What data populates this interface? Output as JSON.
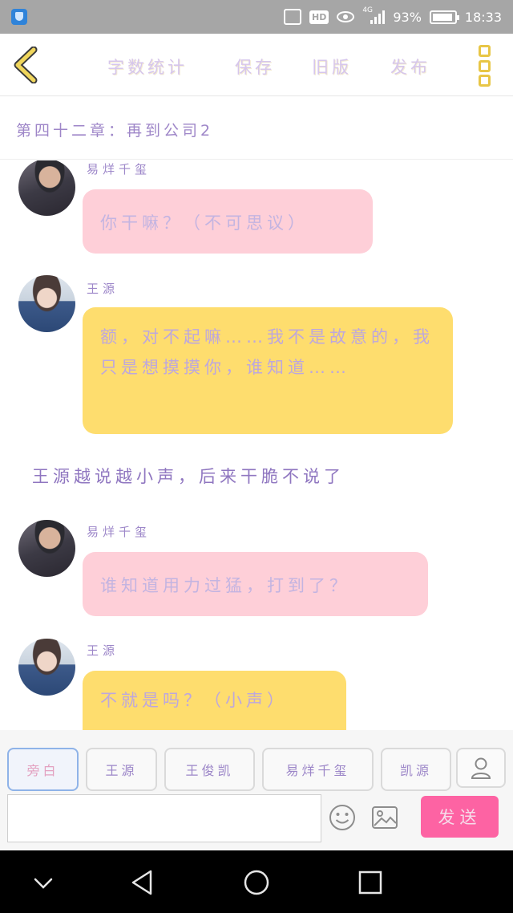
{
  "status_bar": {
    "hd": "HD",
    "network": "4G",
    "battery_level": 0.93,
    "battery_text": "93%",
    "time": "18:33"
  },
  "toolbar": {
    "word_count": "字数统计",
    "save": "保存",
    "old_version": "旧版",
    "publish": "发布"
  },
  "chapter": {
    "title": "第四十二章：再到公司2"
  },
  "messages": [
    {
      "sender": "易烊千玺",
      "text": "你干嘛？（不可思议）"
    },
    {
      "sender": "王源",
      "text": "额，对不起嘛……我不是故意的，我只是想摸摸你，谁知道……"
    },
    {
      "narration": "王源越说越小声，后来干脆不说了"
    },
    {
      "sender": "易烊千玺",
      "text": "谁知道用力过猛，打到了？"
    },
    {
      "sender": "王源",
      "text": "不就是吗？（小声）"
    }
  ],
  "roles": [
    "旁白",
    "王源",
    "王俊凯",
    "易烊千玺",
    "凯源"
  ],
  "input": {
    "placeholder": "",
    "value": ""
  },
  "send_label": "发送",
  "colors": {
    "accent_pink": "#fd63a3",
    "bubble_pink": "#fecfd8",
    "bubble_yellow": "#fedd6e",
    "text_purple": "#9e86c8",
    "menu_yellow": "#e8c646"
  }
}
